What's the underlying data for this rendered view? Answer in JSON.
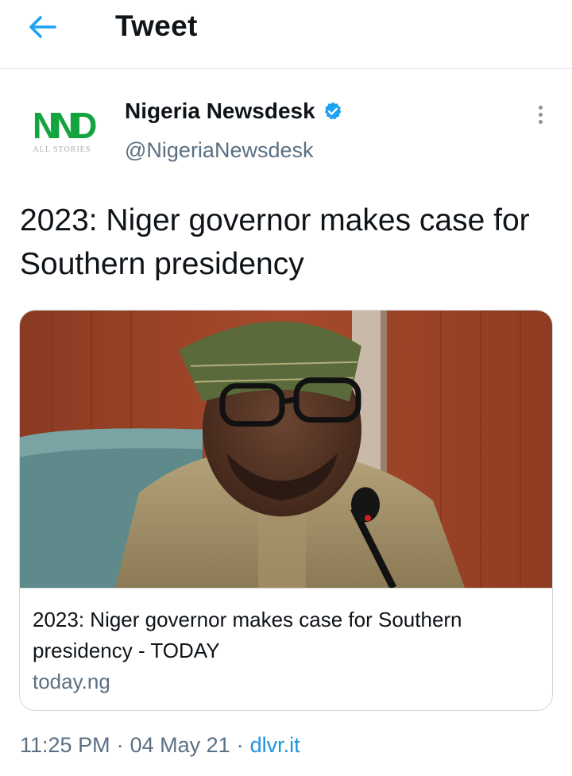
{
  "header": {
    "title": "Tweet",
    "back_icon": "arrow-left-icon",
    "accent": "#1da1f2"
  },
  "tweet": {
    "avatar": {
      "logo_text": "NND",
      "sub_text": "ALL STORIES",
      "brand_color": "#14a43f"
    },
    "author_name": "Nigeria Newsdesk",
    "verified_icon": "verified-badge-icon",
    "author_handle": "@NigeriaNewsdesk",
    "more_icon": "more-vertical-icon",
    "text": "2023: Niger governor makes case for Southern presidency",
    "card": {
      "image_icon": "news-photo-image",
      "title": "2023: Niger governor makes case for Southern presidency - TODAY",
      "domain": "today.ng"
    },
    "time": "11:25 PM",
    "date": "04 May 21",
    "source": "dlvr.it",
    "separator": "·"
  }
}
